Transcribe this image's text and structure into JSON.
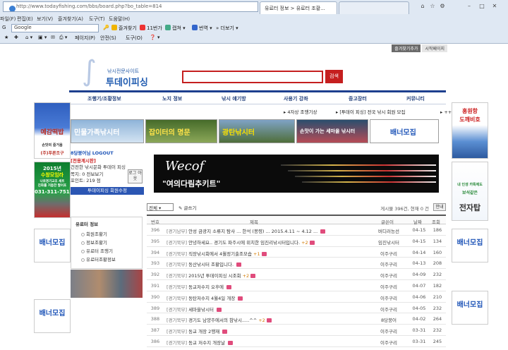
{
  "browser": {
    "url": "http://www.todayfishing.com/bbs/board.php?bo_table=814",
    "tab_active": "유료터 정보 > 유료터 조황...",
    "tab_inactive": "",
    "menu": [
      "파일(F)",
      "편집(E)",
      "보기(V)",
      "즐겨찾기(A)",
      "도구(T)",
      "도움말(H)"
    ],
    "google_placeholder": "Google",
    "google_tools": [
      "즐겨찾기",
      "11번가",
      "캡쳐",
      "번역",
      "더보기"
    ],
    "cmd_tools": [
      "페이지(P)",
      "안전(S)",
      "도구(O)"
    ]
  },
  "site": {
    "top_links": [
      "즐겨찾기추가",
      "시작페이지"
    ],
    "logo_sub": "낚시전문사이트",
    "logo_title": "투데이피싱",
    "search_button": "검색",
    "nav": [
      "조행기/조황정보",
      "노지 정보",
      "낚시 얘기방",
      "사용기 강좌",
      "중고장터",
      "커뮤니티"
    ],
    "ticker": [
      "4자상 조행기상",
      "[투데이 피싱] 전국 낚시 회원 모집",
      "++투데"
    ]
  },
  "banners": {
    "left1": [
      "예감떡밥",
      "손맛의 짜릿한 예감!",
      "손맛의 즐거움",
      "(주)푸른조구"
    ],
    "left2": [
      "2015년",
      "수창모임라",
      "나로경기교조 세트",
      "진화를 거듭한 팔어포",
      "031-311-7512"
    ],
    "right1": [
      "홍원항",
      "도깨비호"
    ],
    "right2": [
      "내 인생 카톡에도",
      "보석같은",
      "전자탑"
    ],
    "recruit": "배너모집",
    "top": [
      "민물가족낚시터",
      "잡이터의 명문",
      "광탄낚시터",
      "손맛이 가는 세마을 낚시터",
      "배너모집"
    ],
    "wecof_title": "Wecof",
    "wecof_sub": "\"여의다림추키트\""
  },
  "login": {
    "user": "8당붕어님 LOGOUT",
    "grade": "[전용계시판]",
    "level": "건전한 낚시문화 투데이 피싱",
    "point_label": "쪽지: 0  전보보기",
    "point": "포인트: 219 점",
    "logout_btn": "로그 아웃",
    "modify_btn": "투데이피싱 회원수정"
  },
  "categories": {
    "title": "유료터 정보",
    "items": [
      "회원조황기",
      "정보조황기",
      "유료터 조행기",
      "유료터조황정보"
    ]
  },
  "board": {
    "select_value": "전체",
    "write_label": "글쓰기",
    "count_text": "게시물 396건, 현재 0 건",
    "info_btn": "안내",
    "headers": [
      "번호",
      "제목",
      "글쓴이",
      "날짜",
      "조회"
    ],
    "rows": [
      {
        "no": "396",
        "pre": "[경기남부]",
        "title": "안성 금광지 소류지 탐사 ... 한석 (봉령) ... 2015.4.11 ~ 4.12 ...",
        "writer": "버디러능선",
        "date": "04-15",
        "views": "186",
        "comments": ""
      },
      {
        "no": "395",
        "pre": "[경기북부]",
        "title": "안녕하세요.. 경기도 파주시에 위치한 임진리낚시터입니다.",
        "writer": "임진낚시터",
        "date": "04-15",
        "views": "134",
        "comments": "+2"
      },
      {
        "no": "394",
        "pre": "[경기북부]",
        "title": "직장낚시회에서 4월정기출조모습",
        "writer": "이주구리",
        "date": "04-14",
        "views": "160",
        "comments": "+1"
      },
      {
        "no": "393",
        "pre": "[경기북부]",
        "title": "동산낚시터 조황입니다.",
        "writer": "이주구리",
        "date": "04-13",
        "views": "208",
        "comments": ""
      },
      {
        "no": "392",
        "pre": "[경기북부]",
        "title": "2015년 투데이피싱 시조회",
        "writer": "이주구리",
        "date": "04-09",
        "views": "232",
        "comments": "+2"
      },
      {
        "no": "391",
        "pre": "[경기북부]",
        "title": "동교저수지 오후에",
        "writer": "이주구리",
        "date": "04-07",
        "views": "182",
        "comments": ""
      },
      {
        "no": "390",
        "pre": "[경기북부]",
        "title": "동탄저수지 4월4일 개장",
        "writer": "이주구리",
        "date": "04-06",
        "views": "210",
        "comments": ""
      },
      {
        "no": "389",
        "pre": "[경기북부]",
        "title": "세마을낚시터",
        "writer": "이주구리",
        "date": "04-05",
        "views": "232",
        "comments": ""
      },
      {
        "no": "388",
        "pre": "[경기북부]",
        "title": "경기도 남양주에서의 참낚시.....^^",
        "writer": "8당붕어",
        "date": "04-02",
        "views": "264",
        "comments": "+2"
      },
      {
        "no": "387",
        "pre": "[경기북부]",
        "title": "동교 개장 2행재",
        "writer": "이주구리",
        "date": "03-31",
        "views": "232",
        "comments": ""
      },
      {
        "no": "386",
        "pre": "[경기북부]",
        "title": "동교 저수지 개장날",
        "writer": "이주구리",
        "date": "03-31",
        "views": "245",
        "comments": ""
      }
    ]
  }
}
